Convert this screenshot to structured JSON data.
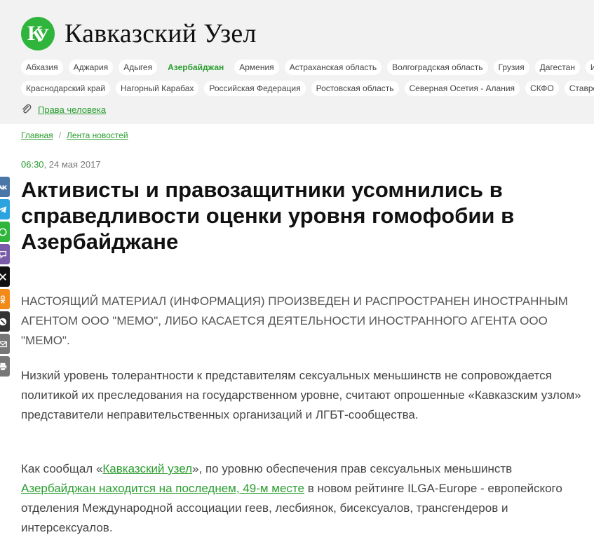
{
  "site": {
    "logo_letter_1": "К",
    "logo_letter_2": "У",
    "title": "Кавказский Узел"
  },
  "regions_row_1": [
    "Абхазия",
    "Аджария",
    "Адыгея",
    "Азербайджан",
    "Армения",
    "Астраханская область",
    "Волгоградская область",
    "Грузия",
    "Дагестан",
    "Ин"
  ],
  "regions_row_2": [
    "Краснодарский край",
    "Нагорный Карабах",
    "Российская Федерация",
    "Ростовская область",
    "Северная Осетия - Алания",
    "СКФО",
    "Ставропо"
  ],
  "active_region": "Азербайджан",
  "rights_link": "Права человека",
  "breadcrumb": {
    "home": "Главная",
    "separator": "/",
    "feed": "Лента новостей"
  },
  "article": {
    "time": "06:30",
    "date": ", 24 мая 2017",
    "headline": "Активисты и правозащитники усомнились в справедливости оценки уровня гомофобии в Азербайджане",
    "notice": "НАСТОЯЩИЙ МАТЕРИАЛ (ИНФОРМАЦИЯ) ПРОИЗВЕДЕН И РАСПРОСТРАНЕН ИНОСТРАННЫМ АГЕНТОМ ООО \"МЕМО\", ЛИБО КАСАЕТСЯ ДЕЯТЕЛЬНОСТИ ИНОСТРАННОГО АГЕНТА ООО \"МЕМО\".",
    "paragraph_1": "Низкий уровень толерантности к представителям сексуальных меньшинств не сопровождается политикой их преследования на государственном уровне, считают опрошенные «Кавказским узлом» представители неправительственных организаций и ЛГБТ-сообщества.",
    "p2_prefix": "Как сообщал «",
    "p2_link_1": "Кавказский узел",
    "p2_mid": "», по уровню обеспечения прав сексуальных меньшинств ",
    "p2_link_2": "Азербайджан находится на последнем, 49-м месте",
    "p2_suffix": " в новом рейтинге ILGA-Europe - европейского отделения Международной ассоциации геев, лесбиянок, бисексуалов, трансгендеров и интерсексуалов."
  },
  "share_buttons": [
    {
      "name": "vk-icon",
      "color": "#4a76a8"
    },
    {
      "name": "telegram-icon",
      "color": "#2aa3df"
    },
    {
      "name": "whatsapp-icon",
      "color": "#2fb53b"
    },
    {
      "name": "viber-icon",
      "color": "#7a5ba8"
    },
    {
      "name": "x-icon",
      "color": "#111111"
    },
    {
      "name": "odnoklassniki-icon",
      "color": "#f28a1a"
    },
    {
      "name": "livejournal-icon",
      "color": "#333333"
    },
    {
      "name": "email-icon",
      "color": "#777777"
    },
    {
      "name": "print-icon",
      "color": "#777777"
    }
  ]
}
